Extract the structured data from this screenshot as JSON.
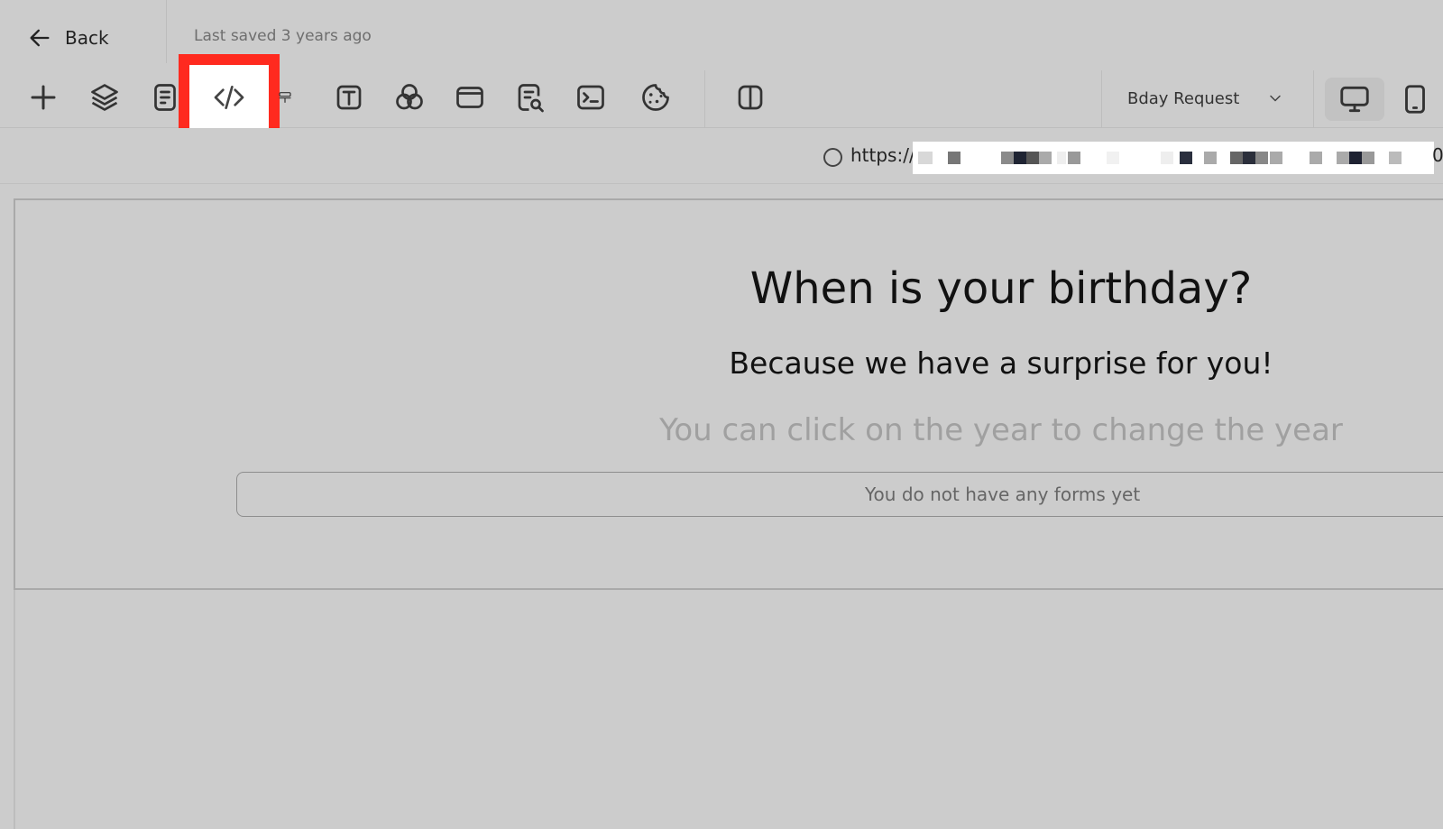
{
  "header": {
    "back_label": "Back",
    "last_saved": "Last saved 3 years ago"
  },
  "toolbar": {
    "icons": [
      "add-icon",
      "layers-icon",
      "page-settings-icon",
      "code-icon",
      "paint-roller-icon",
      "text-icon",
      "color-palette-icon",
      "layout-icon",
      "seo-search-icon",
      "terminal-icon",
      "cookie-icon",
      "split-view-icon"
    ],
    "highlighted_icon": "code-icon",
    "highlight_color": "#ff2a1f",
    "page_select": {
      "selected": "Bday Request"
    },
    "devices": [
      "desktop-icon",
      "mobile-icon"
    ],
    "active_device": "desktop-icon"
  },
  "url": {
    "prefix": "https://",
    "tail": "0"
  },
  "canvas": {
    "title": "When is your birthday?",
    "subtitle": "Because we have a surprise for you!",
    "hint": "You can click on the year to change the year",
    "forms_empty_text": "You do not have any forms yet"
  }
}
